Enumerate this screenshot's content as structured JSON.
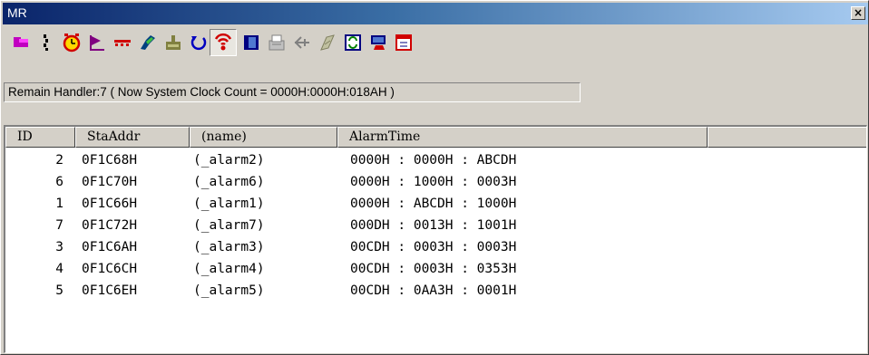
{
  "window": {
    "title": "MR",
    "close_label": "×"
  },
  "toolbar": {
    "buttons": [
      {
        "icon": "task-status-icon"
      },
      {
        "icon": "ready-queue-icon"
      },
      {
        "icon": "timeout-icon"
      },
      {
        "icon": "event-flag-icon"
      },
      {
        "icon": "semaphore-icon"
      },
      {
        "icon": "mailbox-icon"
      },
      {
        "icon": "data-queue-icon"
      },
      {
        "icon": "cyclic-handler-icon"
      },
      {
        "icon": "alarm-handler-icon",
        "pressed": true
      },
      {
        "icon": "memory-pool-icon"
      },
      {
        "icon": "message-buffer-icon"
      },
      {
        "icon": "port-icon"
      },
      {
        "icon": "mutex-icon"
      },
      {
        "icon": "refresh-icon"
      },
      {
        "icon": "context-icon"
      },
      {
        "icon": "timer-queue-icon"
      }
    ]
  },
  "status": {
    "text": "Remain Handler:7 ( Now System Clock Count = 0000H:0000H:018AH )"
  },
  "table": {
    "columns": [
      {
        "label": "ID"
      },
      {
        "label": "StaAddr"
      },
      {
        "label": "(name)"
      },
      {
        "label": "AlarmTime"
      },
      {
        "label": ""
      }
    ],
    "rows": [
      {
        "id": "2",
        "addr": "0F1C68H",
        "name": "(_alarm2)",
        "time": "0000H : 0000H : ABCDH"
      },
      {
        "id": "6",
        "addr": "0F1C70H",
        "name": "(_alarm6)",
        "time": "0000H : 1000H : 0003H"
      },
      {
        "id": "1",
        "addr": "0F1C66H",
        "name": "(_alarm1)",
        "time": "0000H : ABCDH : 1000H"
      },
      {
        "id": "7",
        "addr": "0F1C72H",
        "name": "(_alarm7)",
        "time": "000DH : 0013H : 1001H"
      },
      {
        "id": "3",
        "addr": "0F1C6AH",
        "name": "(_alarm3)",
        "time": "00CDH : 0003H : 0003H"
      },
      {
        "id": "4",
        "addr": "0F1C6CH",
        "name": "(_alarm4)",
        "time": "00CDH : 0003H : 0353H"
      },
      {
        "id": "5",
        "addr": "0F1C6EH",
        "name": "(_alarm5)",
        "time": "00CDH : 0AA3H : 0001H"
      }
    ]
  },
  "colors": {
    "title_bar_start": "#0a246a",
    "title_bar_end": "#a6caf0",
    "face": "#d4d0c8"
  }
}
